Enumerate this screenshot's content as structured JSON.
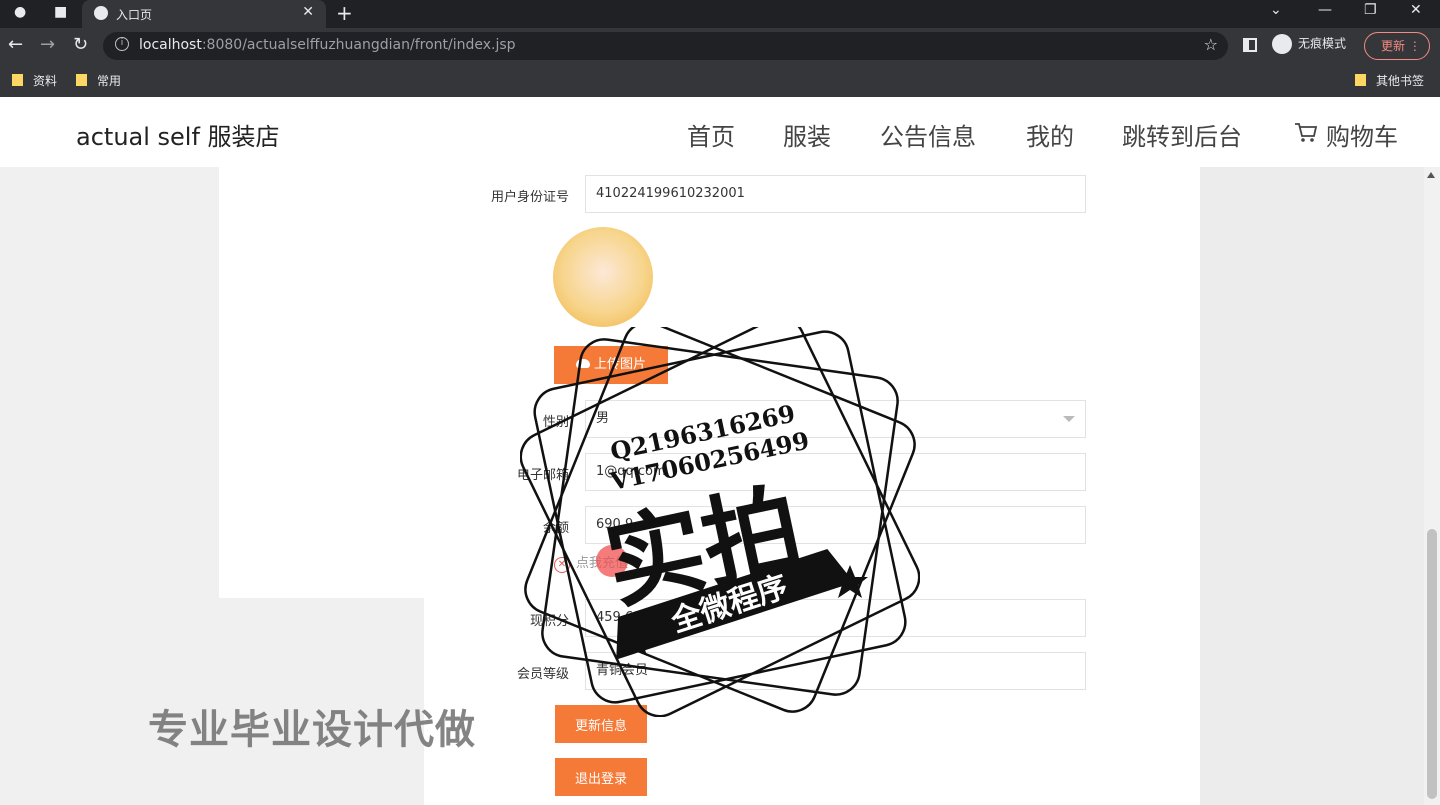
{
  "browser": {
    "tab_title": "入口页",
    "url_host": "localhost",
    "url_rest": ":8080/actualselffuzhuangdian/front/index.jsp",
    "incognito_label": "无痕模式",
    "update_label": "更新",
    "bookmarks": [
      "资料",
      "常用"
    ],
    "other_bookmarks": "其他书签"
  },
  "site": {
    "brand": "actual self 服装店",
    "nav": [
      "首页",
      "服装",
      "公告信息",
      "我的",
      "跳转到后台",
      "购物车"
    ]
  },
  "form": {
    "id_label": "用户身份证号",
    "id_value": "410224199610232001",
    "upload_label": "上传图片",
    "gender_label": "性别",
    "gender_value": "男",
    "email_label": "电子邮箱",
    "email_value": "1@qq.com",
    "balance_label": "余额",
    "balance_value": "690.9",
    "recharge_label": "点我充值",
    "points_label": "现积分",
    "points_value": "459.69",
    "level_label": "会员等级",
    "level_value": "青铜会员",
    "update_button": "更新信息",
    "logout_button": "退出登录"
  },
  "overlay": {
    "contact_q": "Q2196316269",
    "contact_v": "V17060256499",
    "stamp_main": "实拍",
    "stamp_banner": "全微程序",
    "side_text": "专业毕业设计代做"
  }
}
